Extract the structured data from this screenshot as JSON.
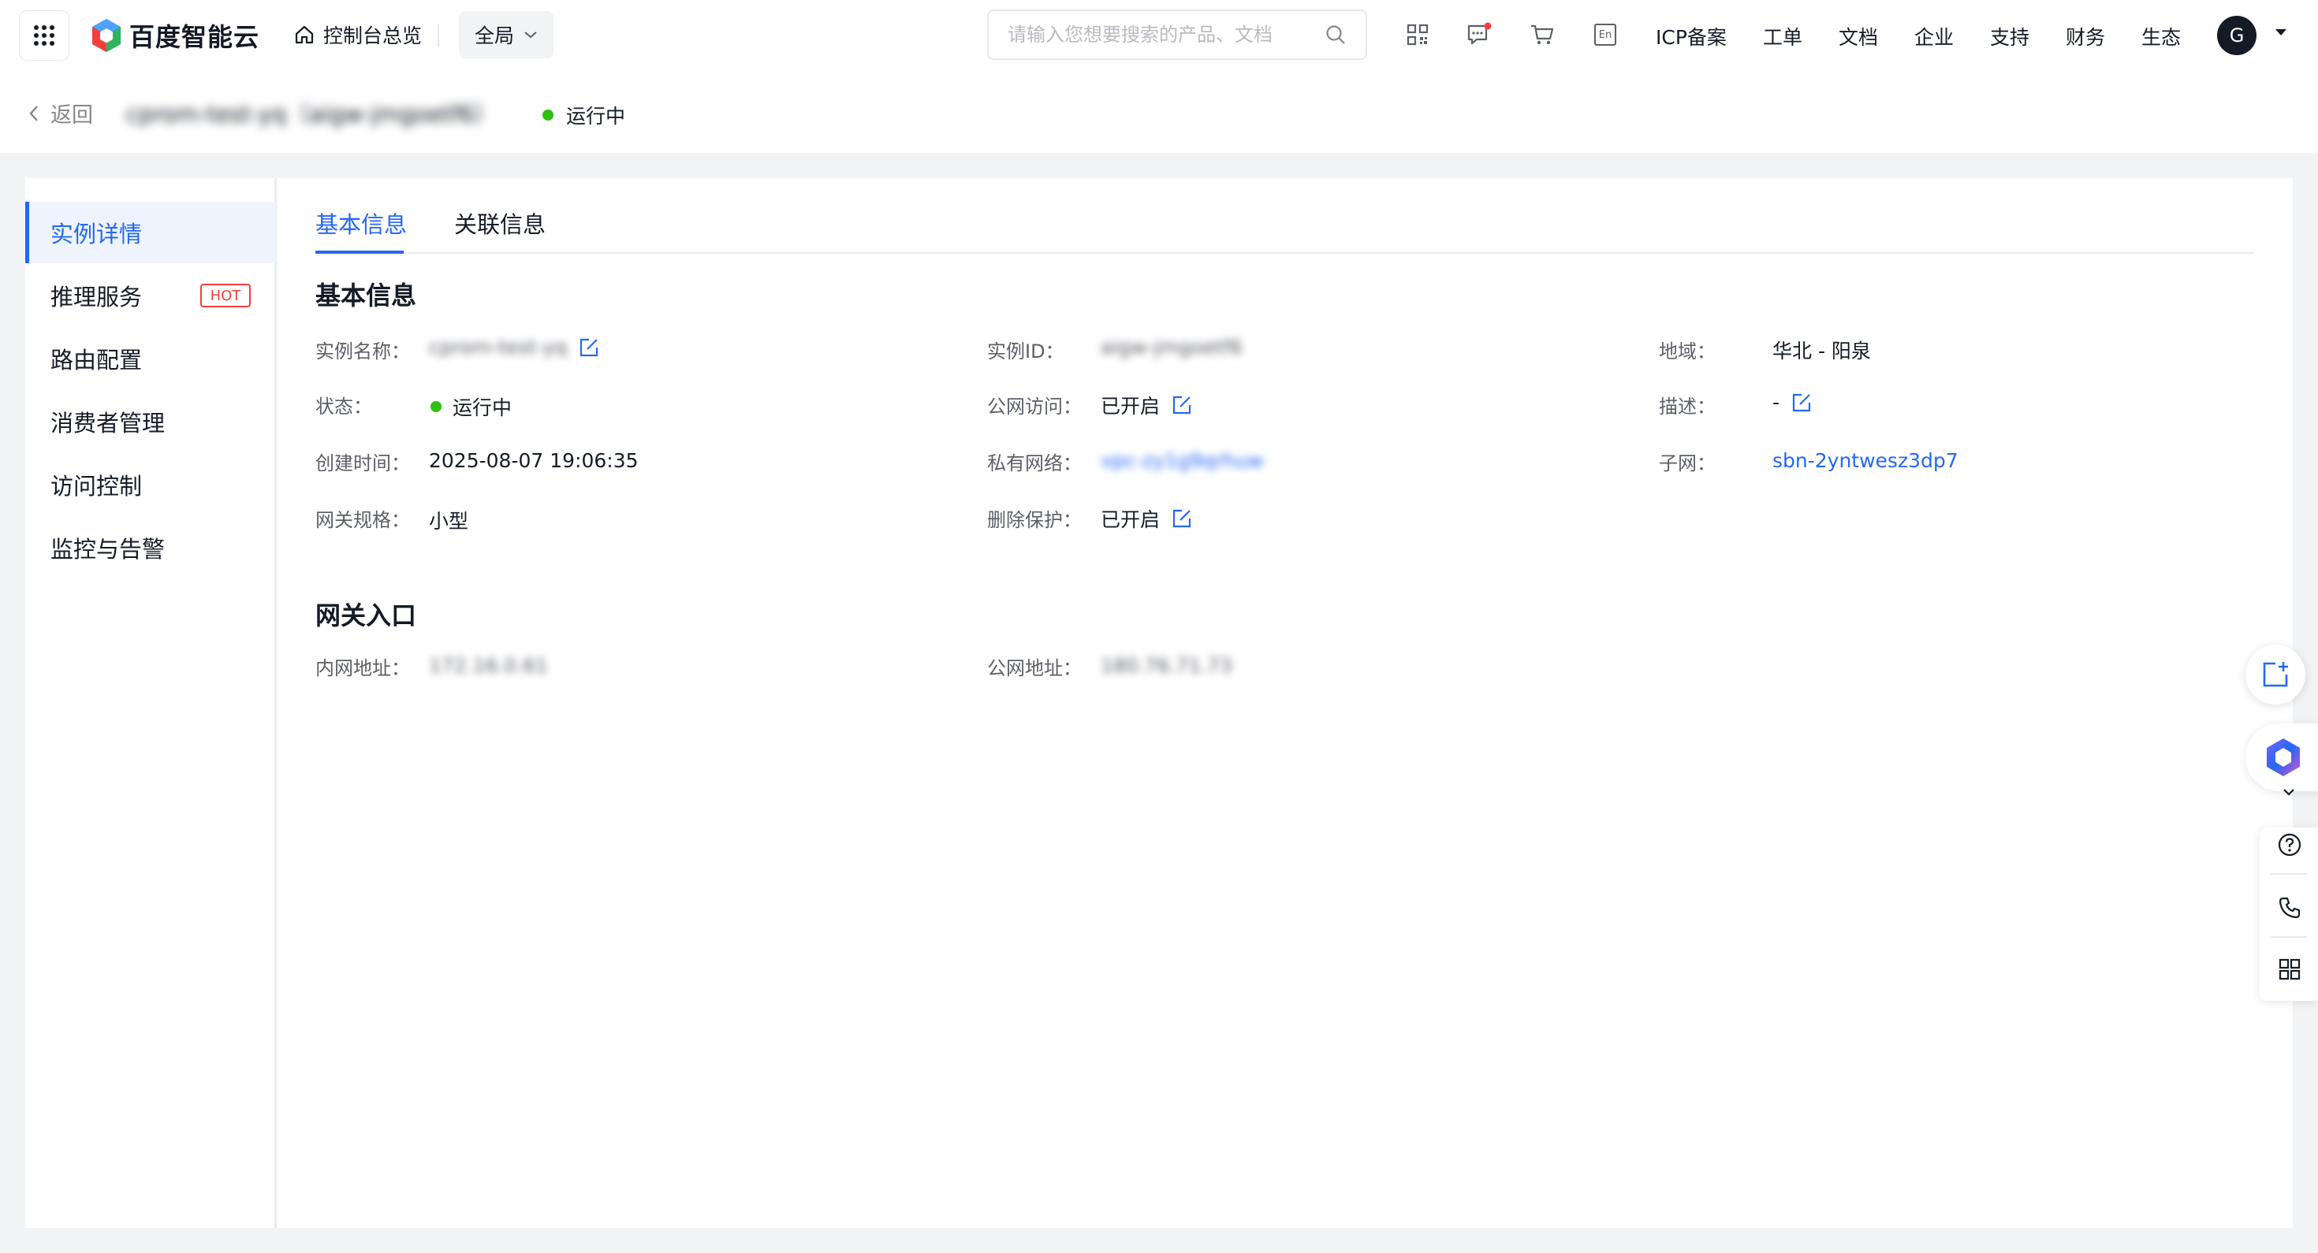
{
  "topbar": {
    "brand": "百度智能云",
    "console_home": "控制台总览",
    "scope": "全局",
    "search_placeholder": "请输入您想要搜索的产品、文档",
    "lang_badge": "En",
    "links": [
      "ICP备案",
      "工单",
      "文档",
      "企业",
      "支持",
      "财务",
      "生态"
    ],
    "avatar_letter": "G"
  },
  "header": {
    "back": "返回",
    "instance_title": "cprom-test-yq（aigw-jmgoetf6）",
    "status": "运行中"
  },
  "sidebar": {
    "items": [
      {
        "label": "实例详情"
      },
      {
        "label": "推理服务",
        "badge": "HOT"
      },
      {
        "label": "路由配置"
      },
      {
        "label": "消费者管理"
      },
      {
        "label": "访问控制"
      },
      {
        "label": "监控与告警"
      }
    ]
  },
  "tabs": [
    "基本信息",
    "关联信息"
  ],
  "basic": {
    "title": "基本信息",
    "name_label": "实例名称：",
    "name_value": "cprom-test-yq",
    "status_label": "状态：",
    "status_value": "运行中",
    "created_label": "创建时间：",
    "created_value": "2025-08-07 19:06:35",
    "spec_label": "网关规格：",
    "spec_value": "小型",
    "id_label": "实例ID：",
    "id_value": "aigw-jmgoetf6",
    "public_label": "公网访问：",
    "public_value": "已开启",
    "vpc_label": "私有网络：",
    "vpc_value": "vpc-zy1g9qrhuw",
    "protect_label": "删除保护：",
    "protect_value": "已开启",
    "region_label": "地域：",
    "region_value": "华北 - 阳泉",
    "desc_label": "描述：",
    "desc_value": "-",
    "subnet_label": "子网：",
    "subnet_value": "sbn-2yntwesz3dp7"
  },
  "entry": {
    "title": "网关入口",
    "inner_label": "内网地址：",
    "inner_value": "172.16.0.61",
    "public_label": "公网地址：",
    "public_value": "180.76.71.73"
  },
  "colors": {
    "primary": "#2468f2",
    "success": "#30bf13",
    "hot": "#f33e3e"
  }
}
